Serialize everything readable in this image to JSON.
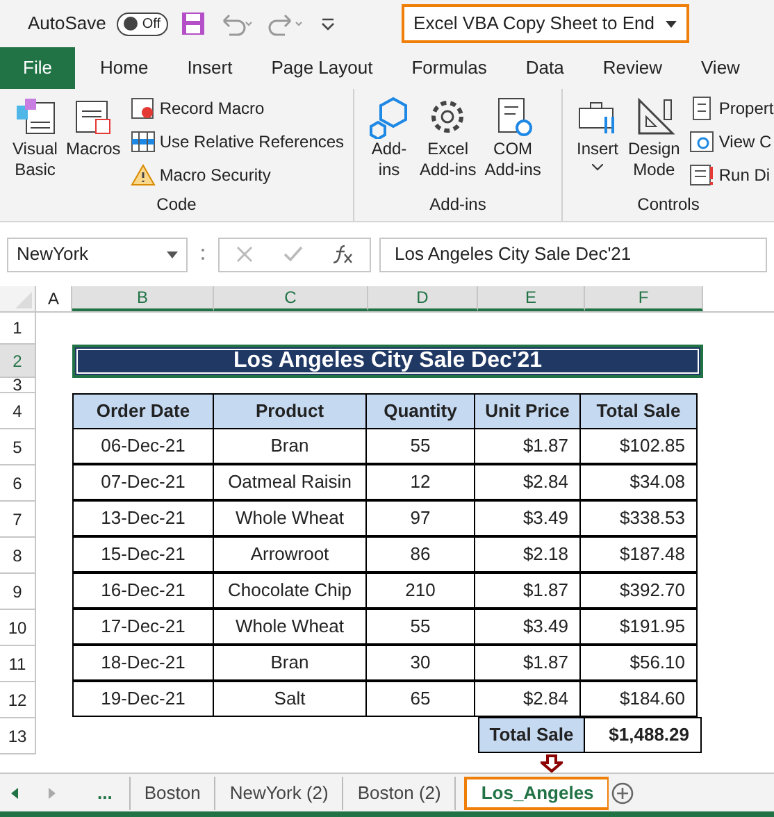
{
  "title_bar": {
    "autosave_label": "AutoSave",
    "autosave_toggle": {
      "label": "Off",
      "on": false
    },
    "workbook_title": "Excel VBA Copy Sheet to End"
  },
  "ribbon_tabs": [
    {
      "label": "File",
      "kind": "file"
    },
    {
      "label": "Home",
      "kind": "tab"
    },
    {
      "label": "Insert",
      "kind": "tab"
    },
    {
      "label": "Page Layout",
      "kind": "tab"
    },
    {
      "label": "Formulas",
      "kind": "tab"
    },
    {
      "label": "Data",
      "kind": "tab"
    },
    {
      "label": "Review",
      "kind": "tab"
    },
    {
      "label": "View",
      "kind": "tab"
    }
  ],
  "ribbon_groups": [
    {
      "name": "Code",
      "large": [
        {
          "lines": [
            "Visual",
            "Basic"
          ]
        },
        {
          "lines": [
            "Macros"
          ]
        }
      ],
      "small": [
        "Record Macro",
        "Use Relative References",
        "Macro Security"
      ]
    },
    {
      "name": "Add-ins",
      "large": [
        {
          "lines": [
            "Add-",
            "ins"
          ]
        },
        {
          "lines": [
            "Excel",
            "Add-ins"
          ]
        },
        {
          "lines": [
            "COM",
            "Add-ins"
          ]
        }
      ]
    },
    {
      "name": "Controls",
      "large": [
        {
          "lines": [
            "Insert"
          ],
          "dropdown": true
        },
        {
          "lines": [
            "Design",
            "Mode"
          ]
        }
      ],
      "small": [
        "Propert",
        "View C",
        "Run Di"
      ]
    }
  ],
  "formula_bar": {
    "name_box": "NewYork",
    "formula": "Los Angeles City Sale Dec'21"
  },
  "columns": [
    "A",
    "B",
    "C",
    "D",
    "E",
    "F"
  ],
  "row_numbers": [
    "1",
    "2",
    "3",
    "4",
    "5",
    "6",
    "7",
    "8",
    "9",
    "10",
    "11",
    "12",
    "13"
  ],
  "sheet": {
    "title": "Los Angeles City Sale Dec'21",
    "headers": [
      "Order Date",
      "Product",
      "Quantity",
      "Unit Price",
      "Total Sale"
    ],
    "rows": [
      [
        "06-Dec-21",
        "Bran",
        "55",
        "$1.87",
        "$102.85"
      ],
      [
        "07-Dec-21",
        "Oatmeal Raisin",
        "12",
        "$2.84",
        "$34.08"
      ],
      [
        "13-Dec-21",
        "Whole Wheat",
        "97",
        "$3.49",
        "$338.53"
      ],
      [
        "15-Dec-21",
        "Arrowroot",
        "86",
        "$2.18",
        "$187.48"
      ],
      [
        "16-Dec-21",
        "Chocolate Chip",
        "210",
        "$1.87",
        "$392.70"
      ],
      [
        "17-Dec-21",
        "Whole Wheat",
        "55",
        "$3.49",
        "$191.95"
      ],
      [
        "18-Dec-21",
        "Bran",
        "30",
        "$1.87",
        "$56.10"
      ],
      [
        "19-Dec-21",
        "Salt",
        "65",
        "$2.84",
        "$184.60"
      ]
    ],
    "total_label": "Total Sale",
    "total_value": "$1,488.29"
  },
  "sheet_tabs": [
    {
      "label": "...",
      "kind": "more",
      "selected": false
    },
    {
      "label": "Boston",
      "kind": "sheet",
      "selected": false
    },
    {
      "label": "NewYork (2)",
      "kind": "sheet",
      "selected": false
    },
    {
      "label": "Boston (2)",
      "kind": "sheet",
      "selected": false
    },
    {
      "label": "Los_Angeles",
      "kind": "sheet",
      "selected": true
    }
  ]
}
